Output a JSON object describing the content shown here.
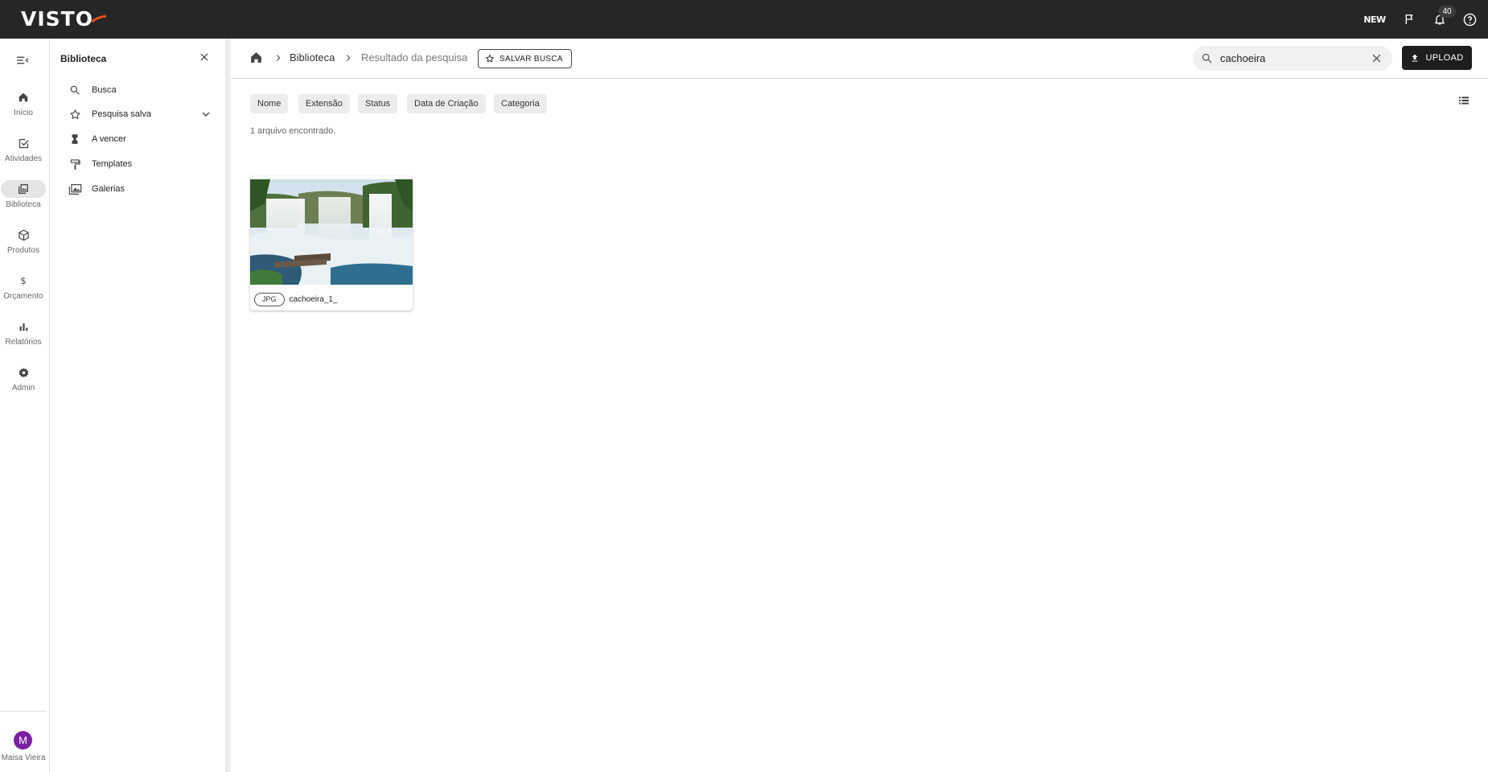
{
  "topbar": {
    "logo_text": "VISTO",
    "new_label": "NEW",
    "notification_count": "40",
    "accent_color": "#e8501f",
    "icons": [
      "new-icon",
      "flag-icon",
      "bell-icon",
      "help-icon"
    ]
  },
  "rail": {
    "items": [
      {
        "label": "Início",
        "icon": "home-icon"
      },
      {
        "label": "Atividades",
        "icon": "checkbox-icon"
      },
      {
        "label": "Biblioteca",
        "icon": "library-icon",
        "active": true
      },
      {
        "label": "Produtos",
        "icon": "cube-icon"
      },
      {
        "label": "Orçamento",
        "icon": "dollar-icon"
      },
      {
        "label": "Relatórios",
        "icon": "bar-chart-icon"
      },
      {
        "label": "Admin",
        "icon": "gear-icon"
      }
    ],
    "user": {
      "initial": "M",
      "name": "Maisa Vieira",
      "color": "#7b1fa2"
    }
  },
  "panel": {
    "title": "Biblioteca",
    "items": [
      {
        "label": "Busca",
        "icon": "search-icon"
      },
      {
        "label": "Pesquisa salva",
        "icon": "star-outline-icon"
      },
      {
        "label": "A vencer",
        "icon": "hourglass-icon"
      },
      {
        "label": "Templates",
        "icon": "format-paint-icon"
      },
      {
        "label": "Galerias",
        "icon": "gallery-icon"
      }
    ]
  },
  "header": {
    "breadcrumbs": [
      "Biblioteca",
      "Resultado da pesquisa"
    ],
    "save_search_label": "SALVAR BUSCA",
    "search_value": "cachoeira",
    "upload_label": "UPLOAD"
  },
  "filters": [
    "Nome",
    "Extensão",
    "Status",
    "Data de Criação",
    "Categoria"
  ],
  "results": {
    "count_text": "1 arquivo encontrado.",
    "files": [
      {
        "extension": "JPG",
        "name": "cachoeira_1_"
      }
    ]
  }
}
